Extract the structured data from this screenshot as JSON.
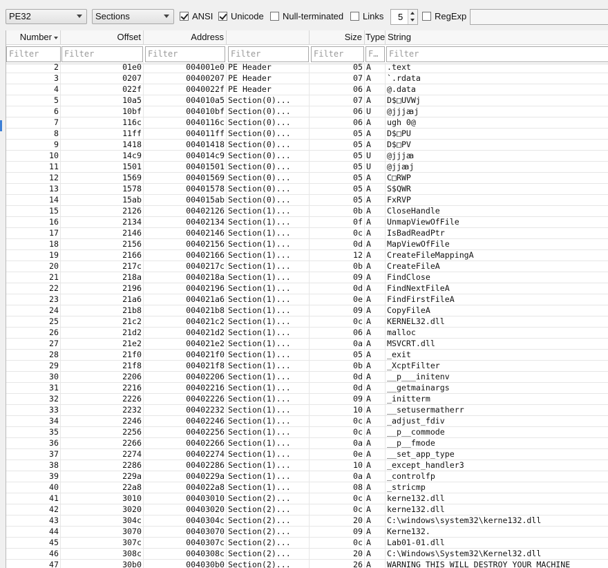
{
  "toolbar": {
    "format": "PE32",
    "scope": "Sections",
    "ansi": {
      "label": "ANSI",
      "checked": true
    },
    "unicode": {
      "label": "Unicode",
      "checked": true
    },
    "null_terminated": {
      "label": "Null-terminated",
      "checked": false
    },
    "links": {
      "label": "Links",
      "checked": false
    },
    "min_length": "5",
    "regexp": {
      "label": "RegExp",
      "checked": false
    },
    "search": ""
  },
  "columns": [
    "Number",
    "Offset",
    "Address",
    "",
    "Size",
    "Type",
    "String"
  ],
  "filter_placeholder": "Filter",
  "rows": [
    [
      "2",
      "01e0",
      "004001e0",
      "PE Header",
      "05",
      "A",
      ".text"
    ],
    [
      "3",
      "0207",
      "00400207",
      "PE Header",
      "07",
      "A",
      "`.rdata"
    ],
    [
      "4",
      "022f",
      "0040022f",
      "PE Header",
      "06",
      "A",
      "@.data"
    ],
    [
      "5",
      "10a5",
      "004010a5",
      "Section(0)...",
      "07",
      "A",
      "D$□UVWj"
    ],
    [
      "6",
      "10bf",
      "004010bf",
      "Section(0)...",
      "06",
      "U",
      "@jjjꜳj"
    ],
    [
      "7",
      "116c",
      "0040116c",
      "Section(0)...",
      "06",
      "A",
      "ugh 0@"
    ],
    [
      "8",
      "11ff",
      "004011ff",
      "Section(0)...",
      "05",
      "A",
      "D$□PU"
    ],
    [
      "9",
      "1418",
      "00401418",
      "Section(0)...",
      "05",
      "A",
      "D$□PV"
    ],
    [
      "10",
      "14c9",
      "004014c9",
      "Section(0)...",
      "05",
      "U",
      "@jjjꜳ"
    ],
    [
      "11",
      "1501",
      "00401501",
      "Section(0)...",
      "05",
      "U",
      "@jjꜳj"
    ],
    [
      "12",
      "1569",
      "00401569",
      "Section(0)...",
      "05",
      "A",
      "C□RWP"
    ],
    [
      "13",
      "1578",
      "00401578",
      "Section(0)...",
      "05",
      "A",
      "S$QWR"
    ],
    [
      "14",
      "15ab",
      "004015ab",
      "Section(0)...",
      "05",
      "A",
      "FxRVP"
    ],
    [
      "15",
      "2126",
      "00402126",
      "Section(1)...",
      "0b",
      "A",
      "CloseHandle"
    ],
    [
      "16",
      "2134",
      "00402134",
      "Section(1)...",
      "0f",
      "A",
      "UnmapViewOfFile"
    ],
    [
      "17",
      "2146",
      "00402146",
      "Section(1)...",
      "0c",
      "A",
      "IsBadReadPtr"
    ],
    [
      "18",
      "2156",
      "00402156",
      "Section(1)...",
      "0d",
      "A",
      "MapViewOfFile"
    ],
    [
      "19",
      "2166",
      "00402166",
      "Section(1)...",
      "12",
      "A",
      "CreateFileMappingA"
    ],
    [
      "20",
      "217c",
      "0040217c",
      "Section(1)...",
      "0b",
      "A",
      "CreateFileA"
    ],
    [
      "21",
      "218a",
      "0040218a",
      "Section(1)...",
      "09",
      "A",
      "FindClose"
    ],
    [
      "22",
      "2196",
      "00402196",
      "Section(1)...",
      "0d",
      "A",
      "FindNextFileA"
    ],
    [
      "23",
      "21a6",
      "004021a6",
      "Section(1)...",
      "0e",
      "A",
      "FindFirstFileA"
    ],
    [
      "24",
      "21b8",
      "004021b8",
      "Section(1)...",
      "09",
      "A",
      "CopyFileA"
    ],
    [
      "25",
      "21c2",
      "004021c2",
      "Section(1)...",
      "0c",
      "A",
      "KERNEL32.dll"
    ],
    [
      "26",
      "21d2",
      "004021d2",
      "Section(1)...",
      "06",
      "A",
      "malloc"
    ],
    [
      "27",
      "21e2",
      "004021e2",
      "Section(1)...",
      "0a",
      "A",
      "MSVCRT.dll"
    ],
    [
      "28",
      "21f0",
      "004021f0",
      "Section(1)...",
      "05",
      "A",
      "_exit"
    ],
    [
      "29",
      "21f8",
      "004021f8",
      "Section(1)...",
      "0b",
      "A",
      "_XcptFilter"
    ],
    [
      "30",
      "2206",
      "00402206",
      "Section(1)...",
      "0d",
      "A",
      "__p___initenv"
    ],
    [
      "31",
      "2216",
      "00402216",
      "Section(1)...",
      "0d",
      "A",
      "__getmainargs"
    ],
    [
      "32",
      "2226",
      "00402226",
      "Section(1)...",
      "09",
      "A",
      "_initterm"
    ],
    [
      "33",
      "2232",
      "00402232",
      "Section(1)...",
      "10",
      "A",
      "__setusermatherr"
    ],
    [
      "34",
      "2246",
      "00402246",
      "Section(1)...",
      "0c",
      "A",
      "_adjust_fdiv"
    ],
    [
      "35",
      "2256",
      "00402256",
      "Section(1)...",
      "0c",
      "A",
      "__p__commode"
    ],
    [
      "36",
      "2266",
      "00402266",
      "Section(1)...",
      "0a",
      "A",
      "__p__fmode"
    ],
    [
      "37",
      "2274",
      "00402274",
      "Section(1)...",
      "0e",
      "A",
      "__set_app_type"
    ],
    [
      "38",
      "2286",
      "00402286",
      "Section(1)...",
      "10",
      "A",
      "_except_handler3"
    ],
    [
      "39",
      "229a",
      "0040229a",
      "Section(1)...",
      "0a",
      "A",
      "_controlfp"
    ],
    [
      "40",
      "22a8",
      "004022a8",
      "Section(1)...",
      "08",
      "A",
      "_stricmp"
    ],
    [
      "41",
      "3010",
      "00403010",
      "Section(2)...",
      "0c",
      "A",
      "kerne132.dll"
    ],
    [
      "42",
      "3020",
      "00403020",
      "Section(2)...",
      "0c",
      "A",
      "kerne132.dll"
    ],
    [
      "43",
      "304c",
      "0040304c",
      "Section(2)...",
      "20",
      "A",
      "C:\\windows\\system32\\kerne132.dll"
    ],
    [
      "44",
      "3070",
      "00403070",
      "Section(2)...",
      "09",
      "A",
      "Kerne132."
    ],
    [
      "45",
      "307c",
      "0040307c",
      "Section(2)...",
      "0c",
      "A",
      "Lab01-01.dll"
    ],
    [
      "46",
      "308c",
      "0040308c",
      "Section(2)...",
      "20",
      "A",
      "C:\\Windows\\System32\\Kernel32.dll"
    ],
    [
      "47",
      "30b0",
      "004030b0",
      "Section(2)...",
      "26",
      "A",
      "WARNING_THIS_WILL_DESTROY_YOUR_MACHINE"
    ]
  ]
}
